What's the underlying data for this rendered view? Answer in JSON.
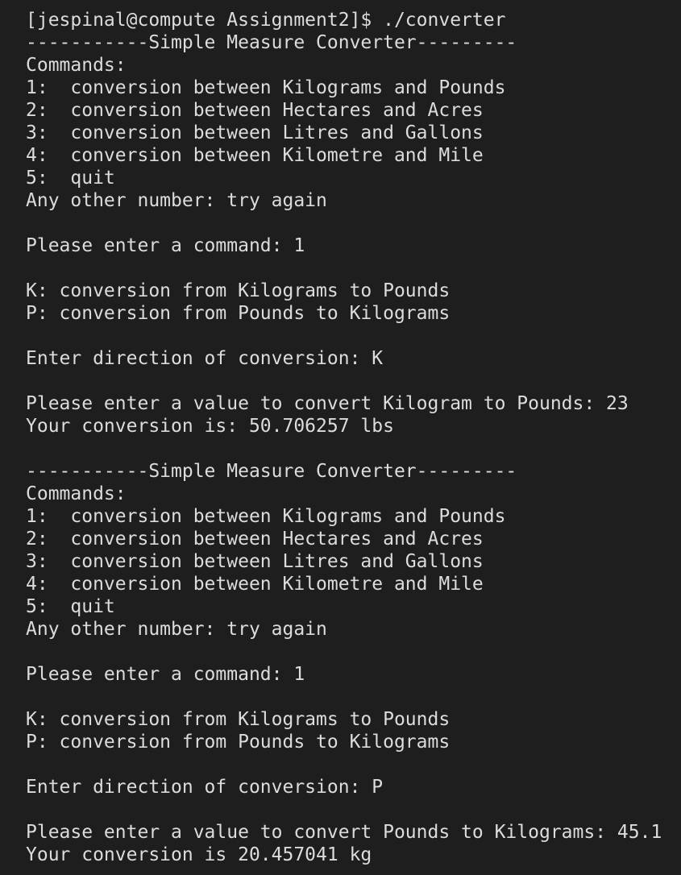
{
  "terminal": {
    "lines": [
      "[jespinal@compute Assignment2]$ ./converter",
      "-----------Simple Measure Converter---------",
      "Commands:",
      "1:  conversion between Kilograms and Pounds",
      "2:  conversion between Hectares and Acres",
      "3:  conversion between Litres and Gallons",
      "4:  conversion between Kilometre and Mile",
      "5:  quit",
      "Any other number: try again",
      "",
      "Please enter a command: 1",
      "",
      "K: conversion from Kilograms to Pounds",
      "P: conversion from Pounds to Kilograms",
      "",
      "Enter direction of conversion: K",
      "",
      "Please enter a value to convert Kilogram to Pounds: 23",
      "Your conversion is: 50.706257 lbs",
      "",
      "-----------Simple Measure Converter---------",
      "Commands:",
      "1:  conversion between Kilograms and Pounds",
      "2:  conversion between Hectares and Acres",
      "3:  conversion between Litres and Gallons",
      "4:  conversion between Kilometre and Mile",
      "5:  quit",
      "Any other number: try again",
      "",
      "Please enter a command: 1",
      "",
      "K: conversion from Kilograms to Pounds",
      "P: conversion from Pounds to Kilograms",
      "",
      "Enter direction of conversion: P",
      "",
      "Please enter a value to convert Pounds to Kilograms: 45.1",
      "Your conversion is 20.457041 kg"
    ],
    "colors": {
      "background": "#1e1e1e",
      "text": "#dcdcdc"
    }
  }
}
